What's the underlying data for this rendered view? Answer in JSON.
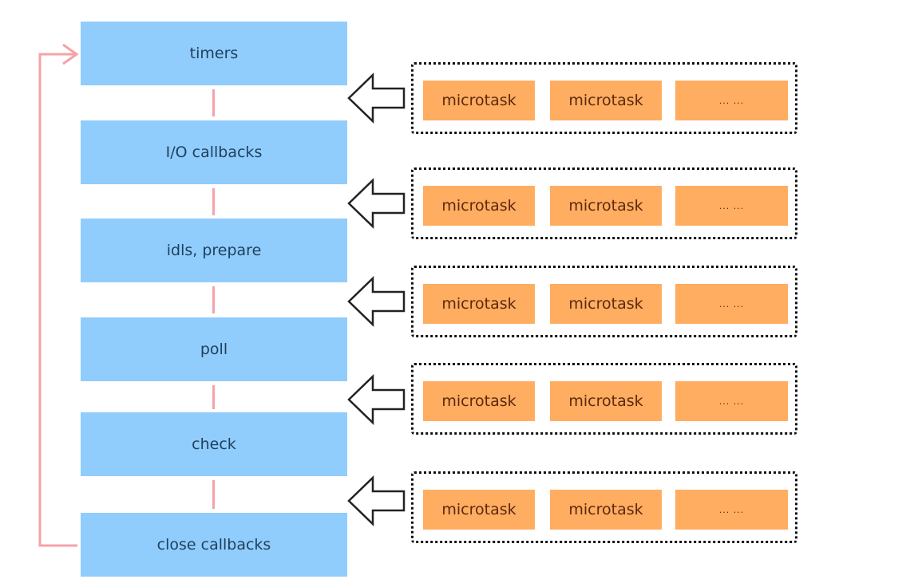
{
  "diagram": {
    "title": "",
    "phases": [
      {
        "label": "timers"
      },
      {
        "label": "I/O callbacks"
      },
      {
        "label": "idls, prepare"
      },
      {
        "label": "poll"
      },
      {
        "label": "check"
      },
      {
        "label": "close callbacks"
      }
    ],
    "microtask_queues": [
      {
        "items": [
          "microtask",
          "microtask",
          "... ..."
        ]
      },
      {
        "items": [
          "microtask",
          "microtask",
          "... ..."
        ]
      },
      {
        "items": [
          "microtask",
          "microtask",
          "... ..."
        ]
      },
      {
        "items": [
          "microtask",
          "microtask",
          "... ..."
        ]
      },
      {
        "items": [
          "microtask",
          "microtask",
          "... ..."
        ]
      }
    ],
    "colors": {
      "phase_fill": "#90cdfc",
      "microtask_fill": "#ffad60",
      "loop_arrow": "#f4a3a8",
      "connector": "#f4a3a8"
    }
  }
}
